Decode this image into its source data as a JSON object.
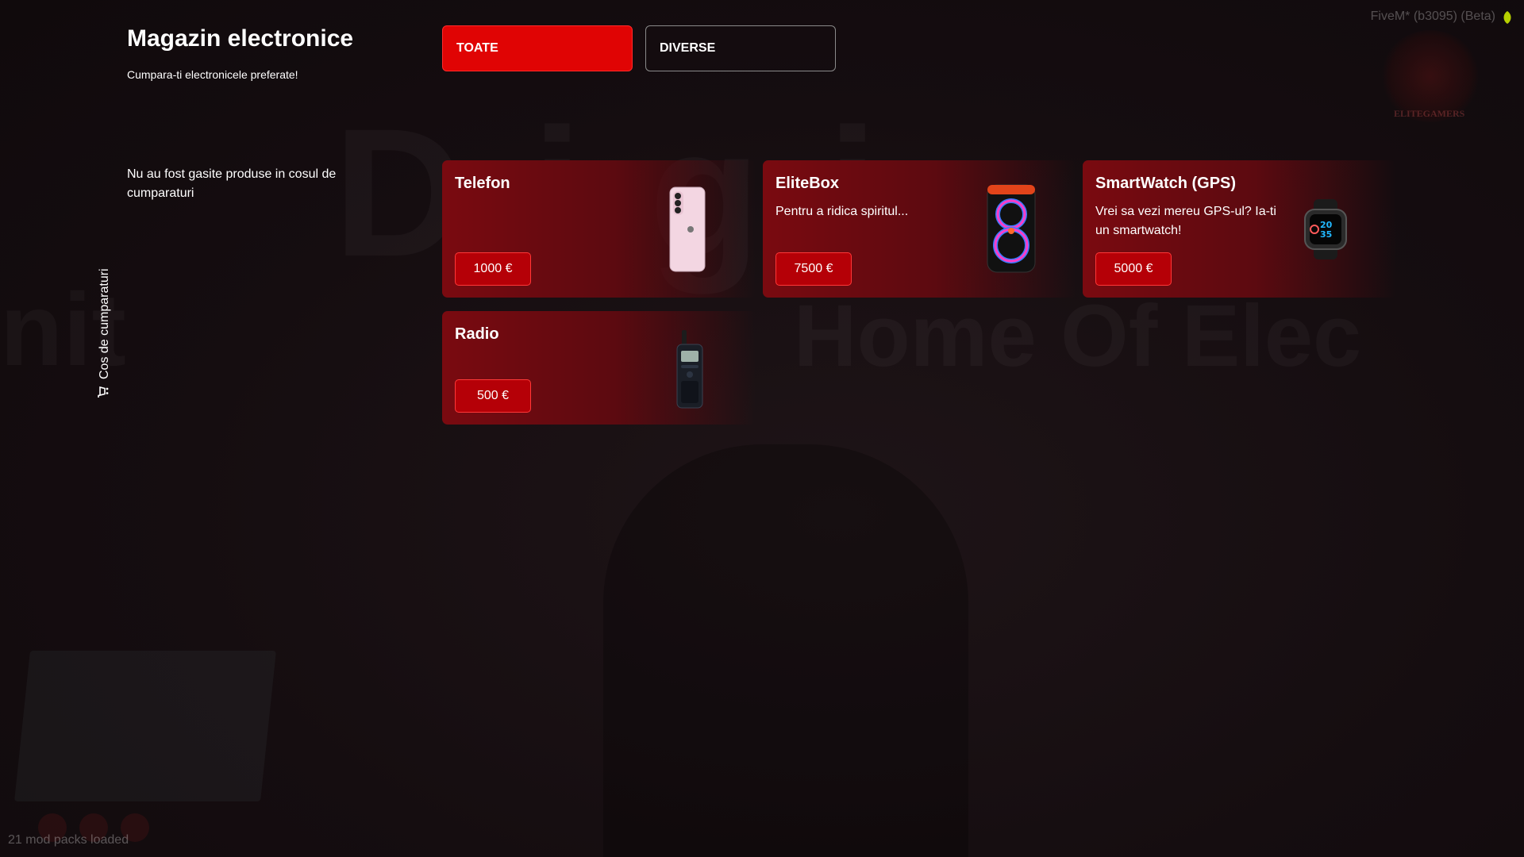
{
  "header": {
    "title": "Magazin electronice",
    "subtitle": "Cumpara-ti electronicele preferate!"
  },
  "tabs": [
    {
      "label": "TOATE",
      "active": true
    },
    {
      "label": "DIVERSE",
      "active": false
    }
  ],
  "cart": {
    "empty_message": "Nu au fost gasite produse in cosul de cumparaturi",
    "tab_label": "Cos de cumparaturi",
    "icon": "cart-icon"
  },
  "products": [
    {
      "name": "Telefon",
      "description": "",
      "price": "1000 €",
      "image": "phone-icon"
    },
    {
      "name": "EliteBox",
      "description": "Pentru a ridica spiritul...",
      "price": "7500 €",
      "image": "speaker-icon"
    },
    {
      "name": "SmartWatch (GPS)",
      "description": "Vrei sa vezi mereu GPS-ul? Ia-ti un smartwatch!",
      "price": "5000 €",
      "image": "smartwatch-icon"
    },
    {
      "name": "Radio",
      "description": "",
      "price": "500 €",
      "image": "radio-icon"
    }
  ],
  "overlay": {
    "client_label": "FiveM* (b3095) (Beta)",
    "server_logo_text": "ELITEGAMERS",
    "mod_packs": "21 mod packs loaded"
  },
  "colors": {
    "accent": "#e00404",
    "card": "#7a0a10",
    "background": "#140d10"
  }
}
